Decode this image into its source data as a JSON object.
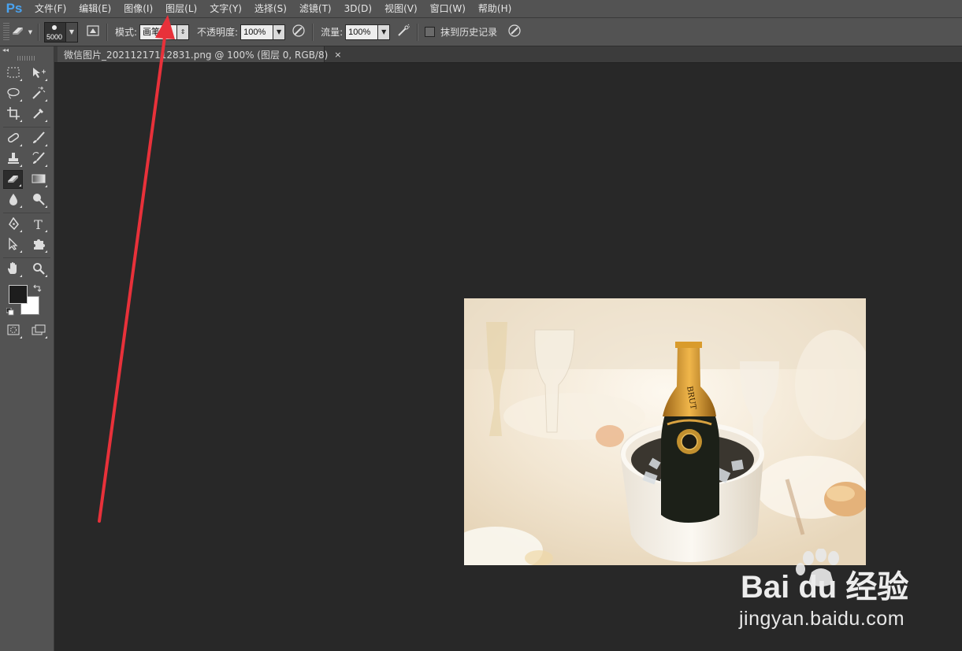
{
  "app": {
    "logo": "Ps"
  },
  "menu": {
    "items": [
      "文件(F)",
      "编辑(E)",
      "图像(I)",
      "图层(L)",
      "文字(Y)",
      "选择(S)",
      "滤镜(T)",
      "3D(D)",
      "视图(V)",
      "窗口(W)",
      "帮助(H)"
    ]
  },
  "options": {
    "brush_size": "5000",
    "mode_label": "模式:",
    "mode_value": "画笔",
    "opacity_label": "不透明度:",
    "opacity_value": "100%",
    "flow_label": "流量:",
    "flow_value": "100%",
    "history_label": "抹到历史记录",
    "history_checked": false
  },
  "document": {
    "tab_title": "微信图片_20211217112831.png @ 100% (图层 0, RGB/8)",
    "close_glyph": "×"
  },
  "toolbox": {
    "collapse_glyph": "◂◂",
    "foreground_color": "#1d1d1d",
    "background_color": "#ffffff"
  },
  "photo": {
    "bottle_label": "BRUT"
  },
  "annotation": {
    "color": "#e8313a"
  },
  "watermark": {
    "brand": "Bai du 经验",
    "url": "jingyan.baidu.com"
  }
}
